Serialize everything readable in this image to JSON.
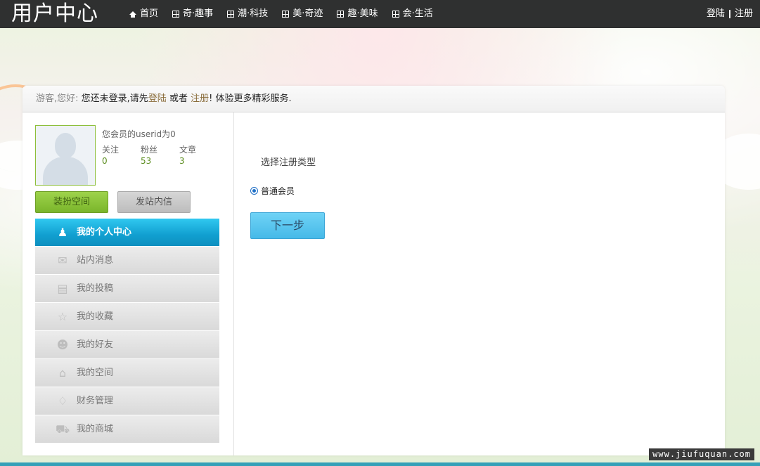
{
  "header": {
    "brand": "用户中心",
    "nav": [
      {
        "label": "首页",
        "icon": "home-icon"
      },
      {
        "label": "奇·趣事",
        "icon": "grid-icon"
      },
      {
        "label": "潮·科技",
        "icon": "grid-icon"
      },
      {
        "label": "美·奇迹",
        "icon": "grid-icon"
      },
      {
        "label": "趣·美味",
        "icon": "grid-icon"
      },
      {
        "label": "会·生活",
        "icon": "grid-icon"
      }
    ],
    "login": "登陆",
    "register": "注册"
  },
  "guest_bar": {
    "greeting": "游客,您好:",
    "text1": "您还未登录,请先",
    "login_link": "登陆",
    "text2": " 或者 ",
    "register_link": "注册",
    "text3": "! 体验更多精彩服务."
  },
  "profile": {
    "userid_text": "您会员的userid为0",
    "stats": [
      {
        "label": "关注",
        "value": "0"
      },
      {
        "label": "粉丝",
        "value": "53"
      },
      {
        "label": "文章",
        "value": "3"
      }
    ],
    "decorate_button": "装扮空间",
    "message_button": "发站内信"
  },
  "menu": [
    {
      "label": "我的个人中心",
      "icon": "user-icon",
      "active": true
    },
    {
      "label": "站内消息",
      "icon": "message-icon",
      "active": false
    },
    {
      "label": "我的投稿",
      "icon": "document-icon",
      "active": false
    },
    {
      "label": "我的收藏",
      "icon": "star-icon",
      "active": false
    },
    {
      "label": "我的好友",
      "icon": "friends-icon",
      "active": false
    },
    {
      "label": "我的空间",
      "icon": "home-space-icon",
      "active": false
    },
    {
      "label": "财务管理",
      "icon": "diamond-icon",
      "active": false
    },
    {
      "label": "我的商城",
      "icon": "cart-icon",
      "active": false
    }
  ],
  "registration": {
    "title": "选择注册类型",
    "option": "普通会员",
    "next_button": "下一步"
  },
  "watermark": "www.jiufuquan.com",
  "colors": {
    "topbar": "#2f3030",
    "accent_blue": "#1fa9dd",
    "accent_green": "#8cc63f"
  }
}
